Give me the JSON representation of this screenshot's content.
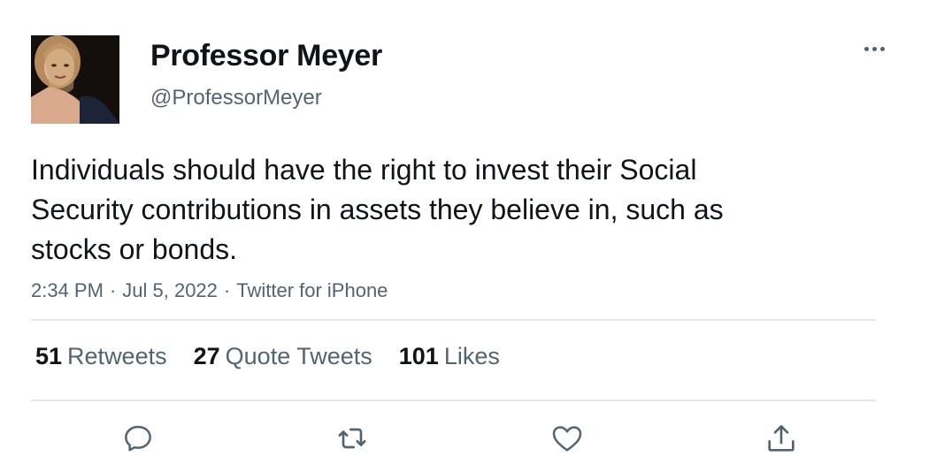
{
  "author": {
    "name": "Professor Meyer",
    "handle": "@ProfessorMeyer"
  },
  "tweet": {
    "text": "Individuals should have the right to invest their Social Security contributions in assets they believe in, such as stocks or bonds.",
    "time": "2:34 PM",
    "date": "Jul 5, 2022",
    "source": "Twitter for iPhone",
    "separator": "·"
  },
  "stats": {
    "retweets": {
      "count": "51",
      "label": "Retweets"
    },
    "quote_tweets": {
      "count": "27",
      "label": "Quote Tweets"
    },
    "likes": {
      "count": "101",
      "label": "Likes"
    }
  },
  "actions": [
    "reply-icon",
    "retweet-icon",
    "like-icon",
    "share-icon"
  ],
  "colors": {
    "text": "#0f1419",
    "secondary": "#536471",
    "divider": "#e5e7ea"
  }
}
